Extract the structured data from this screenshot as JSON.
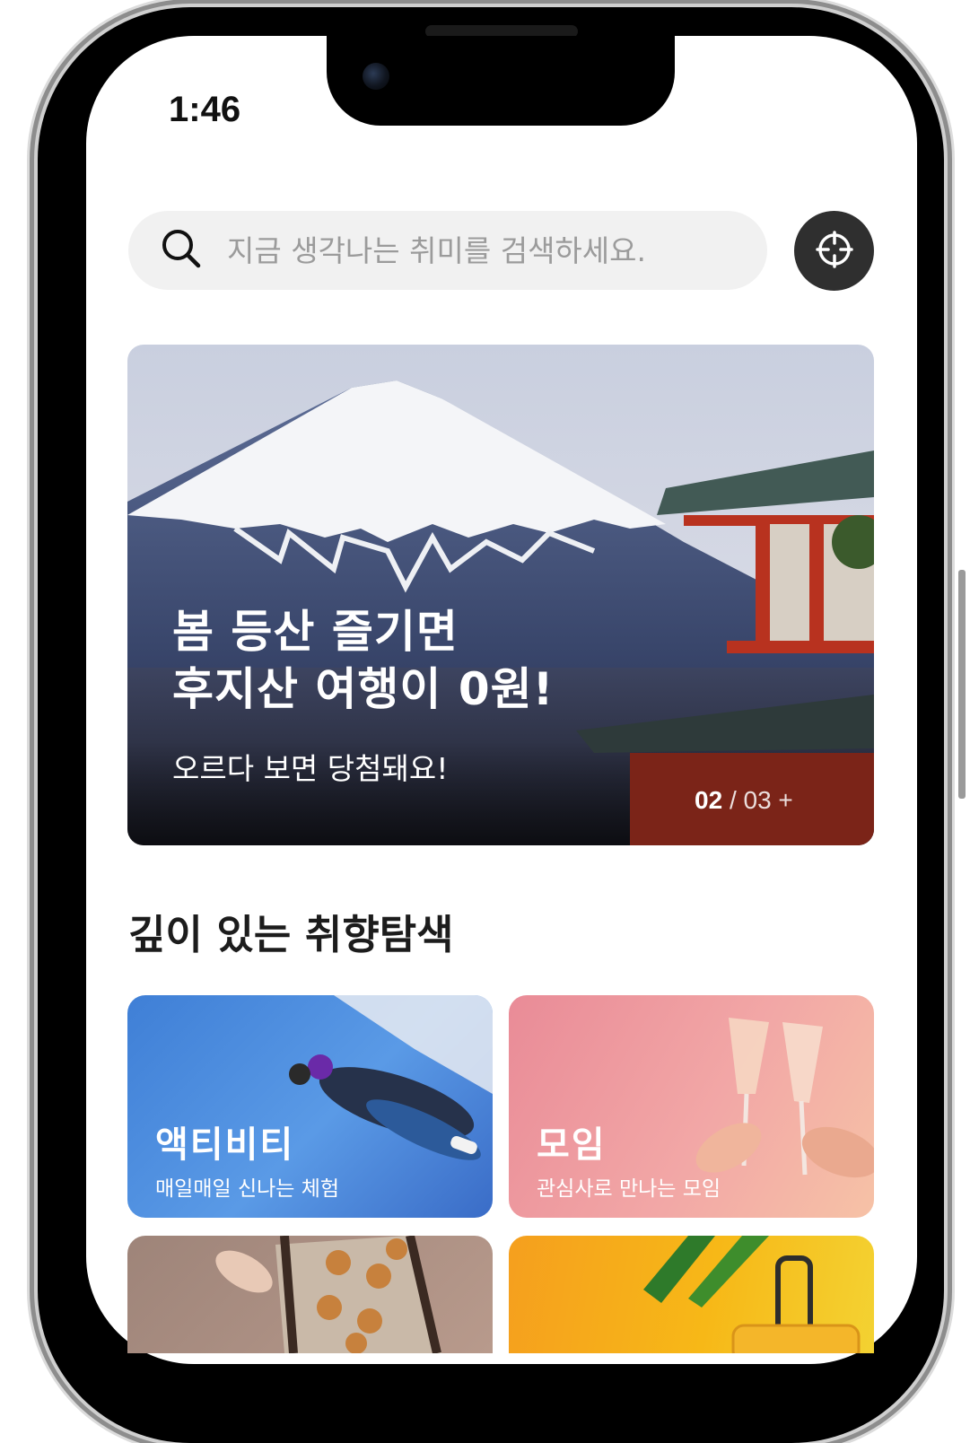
{
  "status_bar": {
    "time": "1:46"
  },
  "search": {
    "placeholder": "지금 생각나는 취미를 검색하세요."
  },
  "banner": {
    "title_line1": "봄 등산 즐기면",
    "title_line2": "후지산 여행이 0원!",
    "subtitle": "오르다 보면 당첨돼요!",
    "counter_current": "02",
    "counter_total": "/ 03 +"
  },
  "section": {
    "title": "깊이 있는 취향탐색"
  },
  "cards": [
    {
      "title": "액티비티",
      "subtitle": "매일매일 신나는 체험"
    },
    {
      "title": "모임",
      "subtitle": "관심사로 만나는 모임"
    },
    {
      "title": "",
      "subtitle": ""
    },
    {
      "title": "",
      "subtitle": ""
    }
  ],
  "icons": {
    "search": "search-icon",
    "location": "crosshair-icon"
  }
}
